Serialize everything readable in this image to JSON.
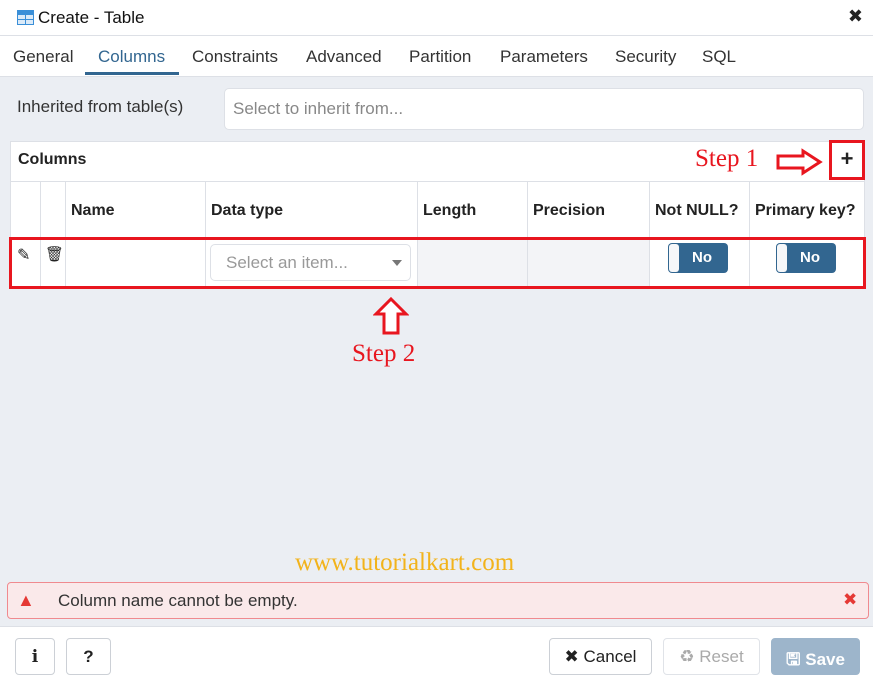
{
  "dialog": {
    "title": "Create - Table",
    "close_icon": "close-icon"
  },
  "tabs": [
    {
      "label": "General"
    },
    {
      "label": "Columns",
      "active": true
    },
    {
      "label": "Constraints"
    },
    {
      "label": "Advanced"
    },
    {
      "label": "Partition"
    },
    {
      "label": "Parameters"
    },
    {
      "label": "Security"
    },
    {
      "label": "SQL"
    }
  ],
  "inherit": {
    "label": "Inherited from table(s)",
    "placeholder": "Select to inherit from..."
  },
  "columns_panel": {
    "title": "Columns",
    "add_label": "+",
    "headers": [
      "Name",
      "Data type",
      "Length",
      "Precision",
      "Not NULL?",
      "Primary key?"
    ],
    "rows": [
      {
        "name": "",
        "data_type_placeholder": "Select an item...",
        "length": "",
        "precision": "",
        "not_null": "No",
        "primary_key": "No"
      }
    ]
  },
  "annotations": {
    "step1": "Step 1",
    "step2": "Step 2",
    "watermark": "www.tutorialkart.com",
    "color": "#e8161f"
  },
  "alert": {
    "message": "Column name cannot be empty.",
    "close": "✖",
    "icon": "warning-icon"
  },
  "footer": {
    "info": "i",
    "help": "?",
    "cancel": "Cancel",
    "reset": "Reset",
    "save": "Save"
  },
  "colors": {
    "accent": "#326690",
    "alert_bg": "#fae9ea",
    "save_disabled": "#9db5cb"
  }
}
